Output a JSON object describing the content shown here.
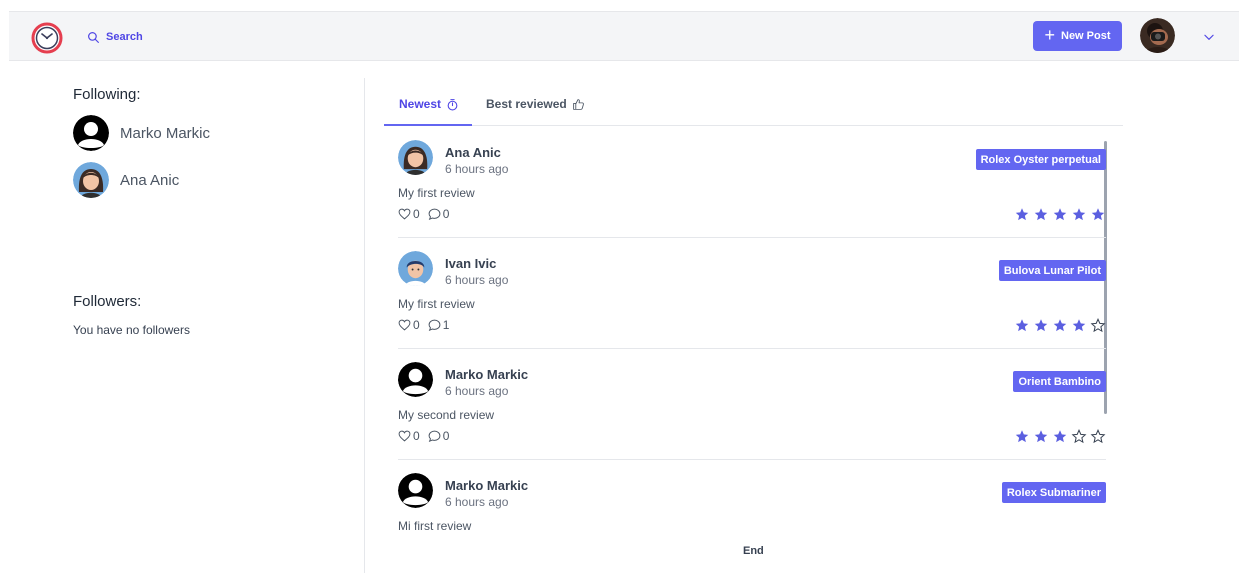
{
  "header": {
    "search_label": "Search",
    "new_post_label": "New Post",
    "accent": "#6366f1"
  },
  "sidebar": {
    "following_title": "Following:",
    "following": [
      {
        "name": "Marko Markic",
        "avatar": "default-user"
      },
      {
        "name": "Ana Anic",
        "avatar": "female"
      }
    ],
    "followers_title": "Followers:",
    "followers_empty": "You have no followers"
  },
  "tabs": [
    {
      "label": "Newest",
      "icon": "stopwatch-icon",
      "active": true
    },
    {
      "label": "Best reviewed",
      "icon": "thumbs-up-icon",
      "active": false
    }
  ],
  "posts": [
    {
      "author": "Ana Anic",
      "time": "6 hours ago",
      "text": "My first review",
      "likes": "0",
      "comments": "0",
      "watch": "Rolex Oyster perpetual",
      "rating": 5,
      "avatar": "female"
    },
    {
      "author": "Ivan Ivic",
      "time": "6 hours ago",
      "text": "My first review",
      "likes": "0",
      "comments": "1",
      "watch": "Bulova Lunar Pilot",
      "rating": 4,
      "avatar": "male"
    },
    {
      "author": "Marko Markic",
      "time": "6 hours ago",
      "text": "My second review",
      "likes": "0",
      "comments": "0",
      "watch": "Orient Bambino",
      "rating": 3,
      "avatar": "default-user"
    },
    {
      "author": "Marko Markic",
      "time": "6 hours ago",
      "text": "Mi first review",
      "watch": "Rolex Submariner",
      "avatar": "default-user"
    }
  ],
  "feed_end": "End"
}
